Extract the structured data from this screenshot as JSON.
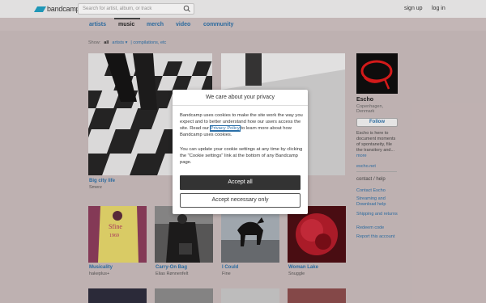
{
  "topbar": {
    "logo": "bandcamp",
    "search_placeholder": "Search for artist, album, or track",
    "signup": "sign up",
    "login": "log in"
  },
  "bandnav": {
    "tabs": [
      "artists",
      "music",
      "merch",
      "video",
      "community"
    ],
    "active_tab": "music"
  },
  "filter": {
    "show_label": "Show:",
    "all": "all",
    "artists": "artists ▾",
    "compilations": "| compilations, etc"
  },
  "albums": [
    {
      "title": "Big city life",
      "artist": "Smerz"
    },
    {
      "title": "Musicality",
      "artist": "hakeplus+"
    },
    {
      "title": "Carry-On Bag",
      "artist": "Elias Rønnenfelt"
    },
    {
      "title": "I Could",
      "artist": "Fine"
    },
    {
      "title": "Woman Lake",
      "artist": "Snuggle"
    }
  ],
  "sidebar": {
    "artist_name": "Escho",
    "location": "Copenhagen, Denmark",
    "follow": "Follow",
    "bio": "Escho is here to document moments of spontaneity, file the transitory and...",
    "more": "more",
    "website": "escho.net",
    "contact_heading": "contact / help",
    "links": [
      "Contact Escho",
      "Streaming and Download help",
      "Shipping and returns",
      "Redeem code",
      "Report this account"
    ]
  },
  "cookie_modal": {
    "title": "We care about your privacy",
    "p1_before": "Bandcamp uses cookies to make the site work the way you expect and to better understand how our users access the site. Read our ",
    "p1_link": "Privacy Policy",
    "p1_after": " to learn more about how Bandcamp uses cookies.",
    "p2": "You can update your cookie settings at any time by clicking the \"Cookie settings\" link at the bottom of any Bandcamp page.",
    "accept_all": "Accept all",
    "accept_necessary": "Accept necessary only"
  },
  "colors": {
    "accent_link": "#2a6fa8",
    "logo": "#1da0c3",
    "page_bg": "#c9bcbc"
  }
}
